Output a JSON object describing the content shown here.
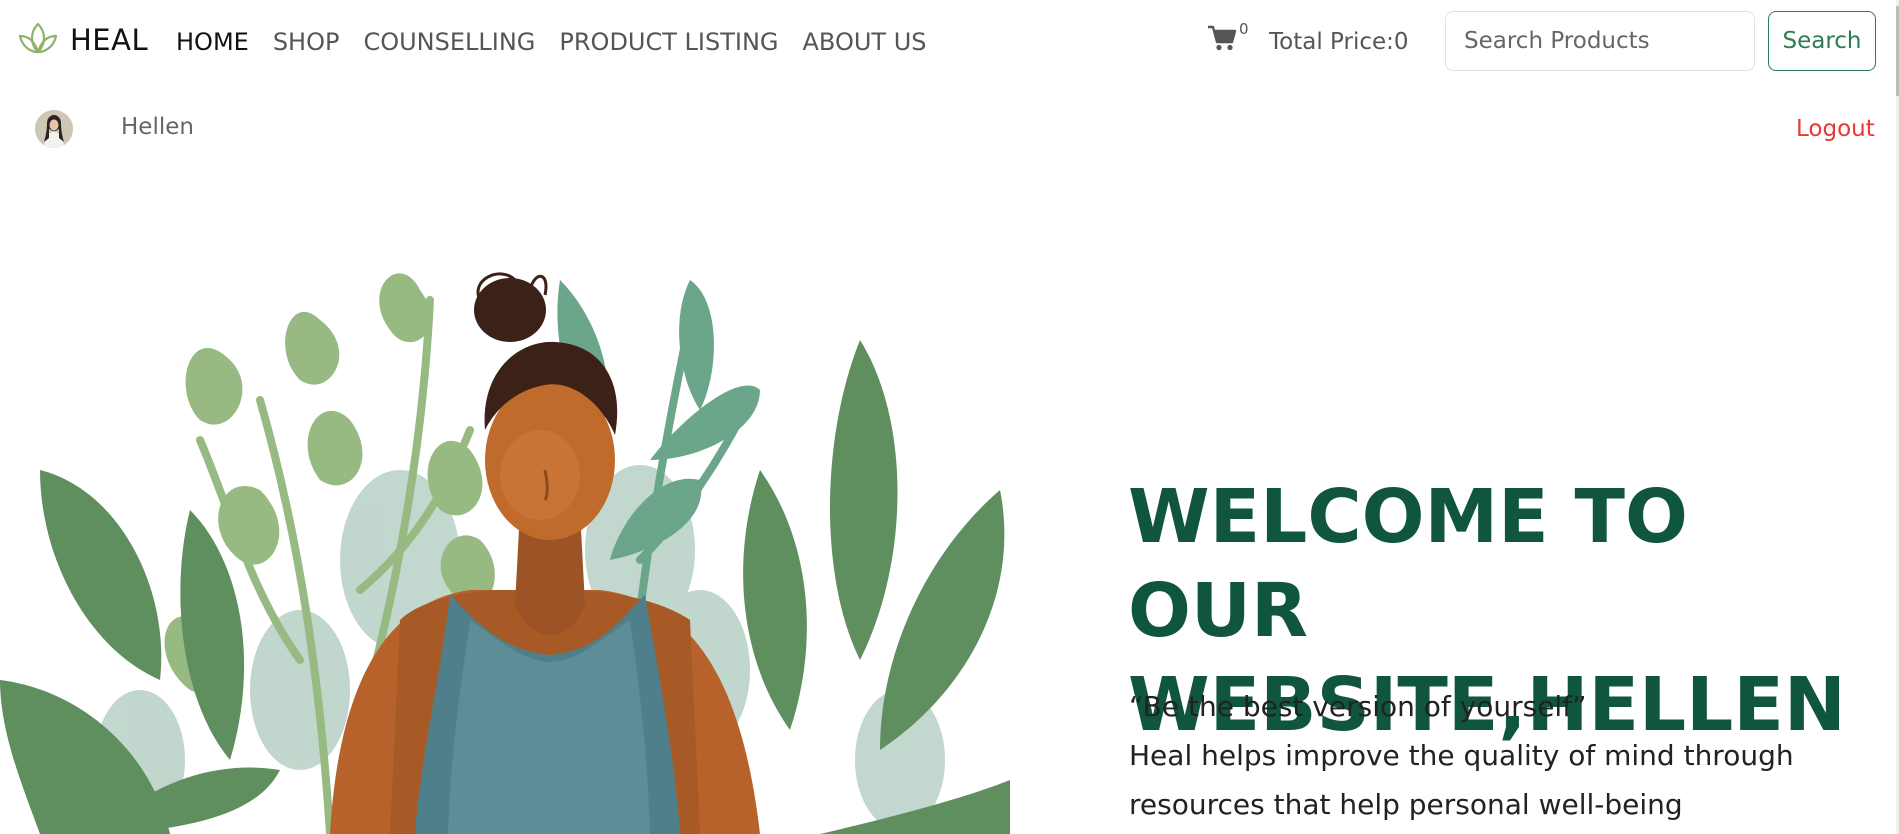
{
  "brand": {
    "name": "HEAL",
    "logo_icon": "lotus-icon",
    "logo_color": "#8cb369"
  },
  "nav": {
    "items": [
      {
        "label": "HOME",
        "active": true
      },
      {
        "label": "SHOP",
        "active": false
      },
      {
        "label": "COUNSELLING",
        "active": false
      },
      {
        "label": "PRODUCT LISTING",
        "active": false
      },
      {
        "label": "ABOUT US",
        "active": false
      }
    ]
  },
  "cart": {
    "icon": "cart-icon",
    "count": "0",
    "total_label": "Total Price:0"
  },
  "search": {
    "placeholder": "Search Products",
    "value": "",
    "button_label": "Search",
    "accent": "#2e7d52"
  },
  "user": {
    "name": "Hellen",
    "avatar_icon": "avatar-photo",
    "logout_label": "Logout",
    "logout_color": "#e53935"
  },
  "hero": {
    "title": "WELCOME TO OUR WEBSITE,HELLEN",
    "title_color": "#0f5540",
    "quote": "“Be the best version of yourself”",
    "line1": "Heal helps improve the quality of mind through",
    "line2": "resources that help personal well-being",
    "illustration": "meditating-woman-with-plants-illustration"
  }
}
